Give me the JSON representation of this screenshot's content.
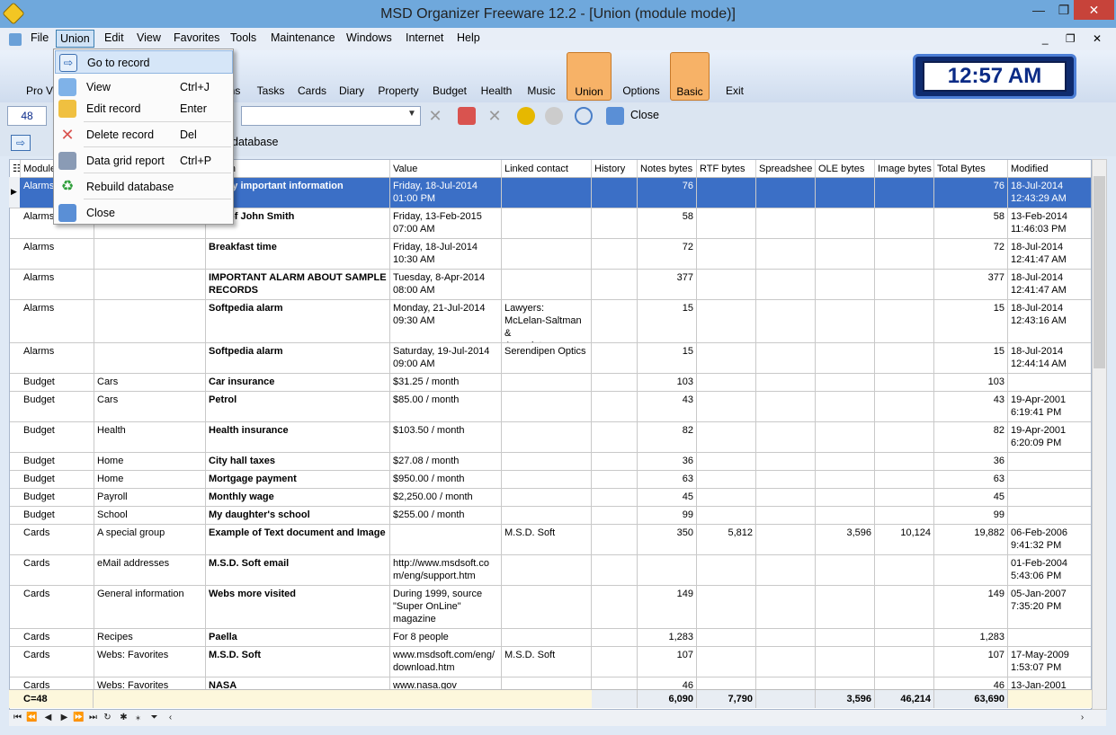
{
  "window": {
    "title": "MSD Organizer Freeware 12.2 - [Union (module mode)]",
    "minimize": "—",
    "maximize": "❐",
    "close": "✕"
  },
  "menubar": [
    "File",
    "Union",
    "Edit",
    "View",
    "Favorites",
    "Tools",
    "Maintenance",
    "Windows",
    "Internet",
    "Help"
  ],
  "mdi_controls": "_ ❐ ✕",
  "toolbar": {
    "items": [
      {
        "label": "Pro Ve",
        "color": "#2b6cb0"
      },
      {
        "label": "ns",
        "color": "#888"
      },
      {
        "label": "Tasks",
        "color": "#d9534f"
      },
      {
        "label": "Cards",
        "color": "#8b5a2b"
      },
      {
        "label": "Diary",
        "color": "#ffd24d"
      },
      {
        "label": "Property",
        "color": "#f0ad4e"
      },
      {
        "label": "Budget",
        "color": "#7aa7d6"
      },
      {
        "label": "Health",
        "color": "#d62728"
      },
      {
        "label": "Music",
        "color": "#555"
      },
      {
        "label": "Union",
        "color": "#e07b39",
        "selected": true
      },
      {
        "label": "Options",
        "color": "#2f6db5"
      },
      {
        "label": "Basic",
        "color": "#4a7fc8",
        "selected": true
      },
      {
        "label": "Exit",
        "color": "#3a8fd6"
      }
    ]
  },
  "clock": "12:57 AM",
  "search": {
    "counter": "48",
    "close_label": "Close"
  },
  "bar2": {
    "label": "database"
  },
  "dropdown": [
    {
      "label": "Go to record",
      "shortcut": "",
      "highlighted": true,
      "icon": "goto-arrow-icon"
    },
    {
      "label": "View",
      "shortcut": "Ctrl+J",
      "icon": "monitor-icon"
    },
    {
      "label": "Edit record",
      "shortcut": "Enter",
      "icon": "pencil-icon"
    },
    {
      "label": "Delete record",
      "shortcut": "Del",
      "icon": "delete-icon"
    },
    {
      "label": "Data grid report",
      "shortcut": "Ctrl+P",
      "icon": "printer-icon"
    },
    {
      "label": "Rebuild database",
      "shortcut": "",
      "icon": "recycle-icon"
    },
    {
      "label": "Close",
      "shortcut": "",
      "icon": "close-door-icon"
    }
  ],
  "grid": {
    "columns": [
      "Module",
      "",
      "ription",
      "Value",
      "Linked contact",
      "History",
      "Notes bytes",
      "RTF bytes",
      "Spreadshee",
      "OLE bytes",
      "Image bytes",
      "Total Bytes",
      "Modified"
    ],
    "rows": [
      {
        "module": "Alarms",
        "cat": "",
        "desc": "up my important information",
        "value": "Friday, 18-Jul-2014\n01:00 PM",
        "linked": "",
        "notes": "76",
        "rtf": "",
        "sheet": "",
        "ole": "",
        "image": "",
        "total": "76",
        "modified": "18-Jul-2014\n12:43:29 AM",
        "selected": true
      },
      {
        "module": "Alarms",
        "cat": "",
        "desc": "day of John Smith",
        "value": "Friday, 13-Feb-2015\n07:00 AM",
        "linked": "",
        "notes": "58",
        "rtf": "",
        "sheet": "",
        "ole": "",
        "image": "",
        "total": "58",
        "modified": "13-Feb-2014\n11:46:03 PM"
      },
      {
        "module": "Alarms",
        "cat": "",
        "desc": "Breakfast time",
        "value": "Friday, 18-Jul-2014\n10:30 AM",
        "linked": "",
        "notes": "72",
        "rtf": "",
        "sheet": "",
        "ole": "",
        "image": "",
        "total": "72",
        "modified": "18-Jul-2014\n12:41:47 AM"
      },
      {
        "module": "Alarms",
        "cat": "",
        "desc": "IMPORTANT ALARM ABOUT SAMPLE RECORDS",
        "value": "Tuesday, 8-Apr-2014\n08:00 AM",
        "linked": "",
        "notes": "377",
        "rtf": "",
        "sheet": "",
        "ole": "",
        "image": "",
        "total": "377",
        "modified": "18-Jul-2014\n12:41:47 AM"
      },
      {
        "module": "Alarms",
        "cat": "",
        "desc": "Softpedia alarm",
        "value": "Monday, 21-Jul-2014\n09:30 AM",
        "linked": "Lawyers:\nMcLelan-Saltman &\nAssociates",
        "notes": "15",
        "rtf": "",
        "sheet": "",
        "ole": "",
        "image": "",
        "total": "15",
        "modified": "18-Jul-2014\n12:43:16 AM"
      },
      {
        "module": "Alarms",
        "cat": "",
        "desc": "Softpedia alarm",
        "value": "Saturday, 19-Jul-2014\n09:00 AM",
        "linked": "Serendipen Optics",
        "notes": "15",
        "rtf": "",
        "sheet": "",
        "ole": "",
        "image": "",
        "total": "15",
        "modified": "18-Jul-2014\n12:44:14 AM"
      },
      {
        "module": "Budget",
        "cat": "Cars",
        "desc": "Car insurance",
        "value": "$31.25 / month",
        "linked": "",
        "notes": "103",
        "rtf": "",
        "sheet": "",
        "ole": "",
        "image": "",
        "total": "103",
        "modified": ""
      },
      {
        "module": "Budget",
        "cat": "Cars",
        "desc": "Petrol",
        "value": "$85.00 / month",
        "linked": "",
        "notes": "43",
        "rtf": "",
        "sheet": "",
        "ole": "",
        "image": "",
        "total": "43",
        "modified": "19-Apr-2001\n6:19:41 PM"
      },
      {
        "module": "Budget",
        "cat": "Health",
        "desc": "Health insurance",
        "value": "$103.50 / month",
        "linked": "",
        "notes": "82",
        "rtf": "",
        "sheet": "",
        "ole": "",
        "image": "",
        "total": "82",
        "modified": "19-Apr-2001\n6:20:09 PM"
      },
      {
        "module": "Budget",
        "cat": "Home",
        "desc": "City hall taxes",
        "value": "$27.08 / month",
        "linked": "",
        "notes": "36",
        "rtf": "",
        "sheet": "",
        "ole": "",
        "image": "",
        "total": "36",
        "modified": ""
      },
      {
        "module": "Budget",
        "cat": "Home",
        "desc": "Mortgage payment",
        "value": "$950.00 / month",
        "linked": "",
        "notes": "63",
        "rtf": "",
        "sheet": "",
        "ole": "",
        "image": "",
        "total": "63",
        "modified": ""
      },
      {
        "module": "Budget",
        "cat": "Payroll",
        "desc": "Monthly wage",
        "value": "$2,250.00 / month",
        "linked": "",
        "notes": "45",
        "rtf": "",
        "sheet": "",
        "ole": "",
        "image": "",
        "total": "45",
        "modified": ""
      },
      {
        "module": "Budget",
        "cat": "School",
        "desc": "My daughter's school",
        "value": "$255.00 / month",
        "linked": "",
        "notes": "99",
        "rtf": "",
        "sheet": "",
        "ole": "",
        "image": "",
        "total": "99",
        "modified": ""
      },
      {
        "module": "Cards",
        "cat": "A special group",
        "desc": "Example of Text document and Image",
        "value": "",
        "linked": "M.S.D. Soft",
        "notes": "350",
        "rtf": "5,812",
        "sheet": "",
        "ole": "3,596",
        "image": "10,124",
        "total": "19,882",
        "modified": "06-Feb-2006\n9:41:32 PM"
      },
      {
        "module": "Cards",
        "cat": "eMail addresses",
        "desc": "M.S.D. Soft email",
        "value": "http://www.msdsoft.co\nm/eng/support.htm",
        "linked": "",
        "notes": "",
        "rtf": "",
        "sheet": "",
        "ole": "",
        "image": "",
        "total": "",
        "modified": "01-Feb-2004\n5:43:06 PM"
      },
      {
        "module": "Cards",
        "cat": "General information",
        "desc": "Webs more visited",
        "value": "During 1999, source\n\"Super OnLine\"\nmagazine",
        "linked": "",
        "notes": "149",
        "rtf": "",
        "sheet": "",
        "ole": "",
        "image": "",
        "total": "149",
        "modified": "05-Jan-2007\n7:35:20 PM"
      },
      {
        "module": "Cards",
        "cat": "Recipes",
        "desc": "Paella",
        "value": "For 8 people",
        "linked": "",
        "notes": "1,283",
        "rtf": "",
        "sheet": "",
        "ole": "",
        "image": "",
        "total": "1,283",
        "modified": ""
      },
      {
        "module": "Cards",
        "cat": "Webs: Favorites",
        "desc": "M.S.D. Soft",
        "value": "www.msdsoft.com/eng/\ndownload.htm",
        "linked": "M.S.D. Soft",
        "notes": "107",
        "rtf": "",
        "sheet": "",
        "ole": "",
        "image": "",
        "total": "107",
        "modified": "17-May-2009\n1:53:07 PM"
      },
      {
        "module": "Cards",
        "cat": "Webs: Favorites",
        "desc": "NASA",
        "value": "www.nasa.gov",
        "linked": "",
        "notes": "46",
        "rtf": "",
        "sheet": "",
        "ole": "",
        "image": "",
        "total": "46",
        "modified": "13-Jan-2001"
      }
    ],
    "footer": {
      "count": "C=48",
      "notes": "6,090",
      "rtf": "7,790",
      "ole": "3,596",
      "image": "46,214",
      "total": "63,690"
    }
  }
}
